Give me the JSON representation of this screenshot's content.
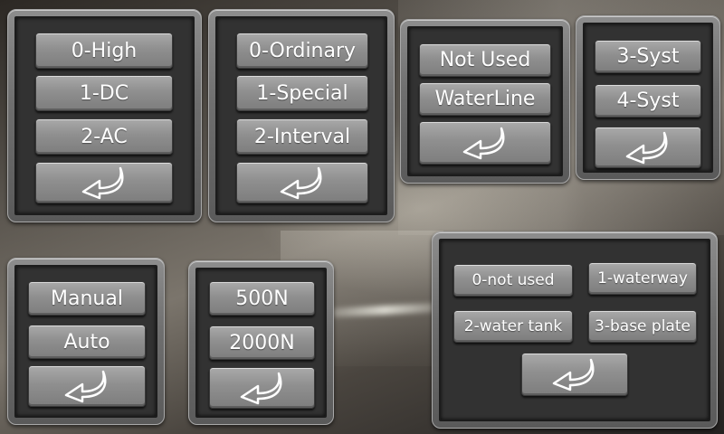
{
  "panel_trigger": {
    "buttons": [
      "0-High",
      "1-DC",
      "2-AC"
    ],
    "back_icon": "return-arrow-icon"
  },
  "panel_mode": {
    "buttons": [
      "0-Ordinary",
      "1-Special",
      "2-Interval"
    ],
    "back_icon": "return-arrow-icon"
  },
  "panel_water": {
    "buttons": [
      "Not Used",
      "WaterLine"
    ],
    "back_icon": "return-arrow-icon"
  },
  "panel_system": {
    "buttons": [
      "3-Syst",
      "4-Syst"
    ],
    "back_icon": "return-arrow-icon"
  },
  "panel_control": {
    "buttons": [
      "Manual",
      "Auto"
    ],
    "back_icon": "return-arrow-icon"
  },
  "panel_force": {
    "buttons": [
      "500N",
      "2000N"
    ],
    "back_icon": "return-arrow-icon"
  },
  "panel_cooling": {
    "buttons": [
      "0-not used",
      "1-waterway",
      "2-water tank",
      "3-base plate"
    ],
    "back_icon": "return-arrow-icon"
  }
}
